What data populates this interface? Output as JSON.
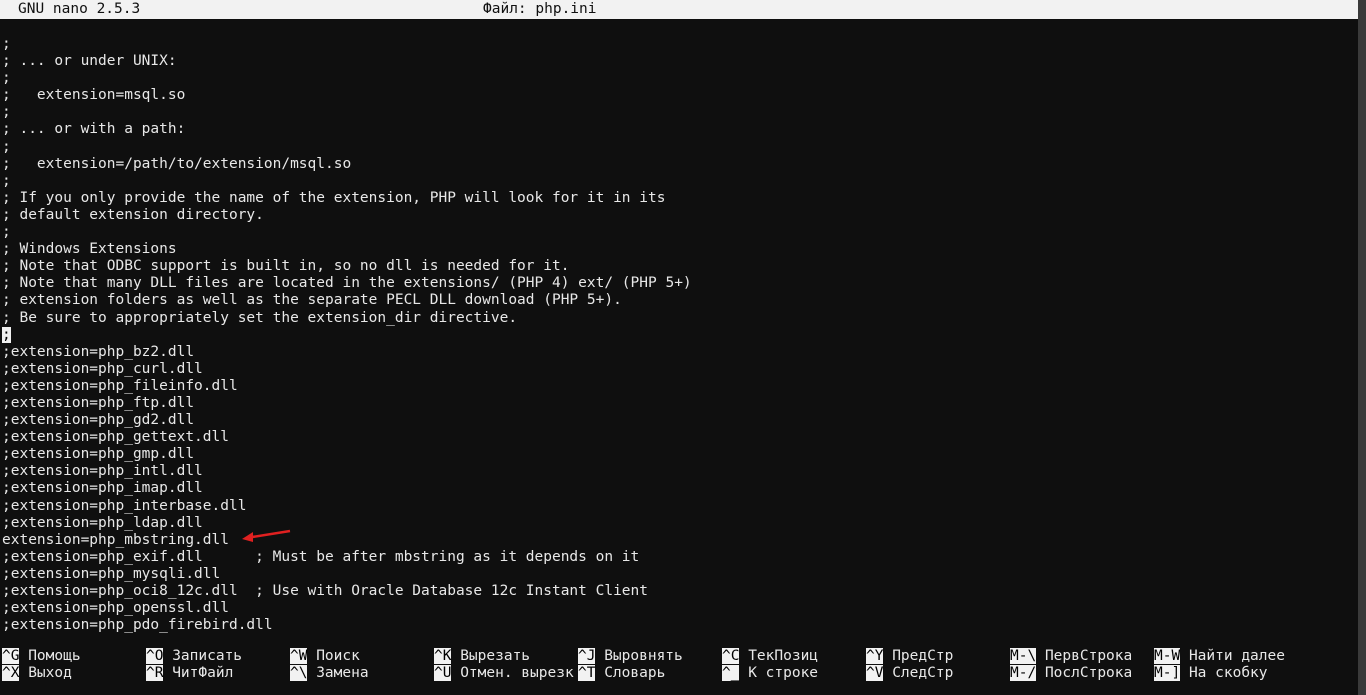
{
  "titlebar": {
    "app": "GNU nano 2.5.3",
    "file": "Файл: php.ini"
  },
  "lines": [
    ";",
    "; ... or under UNIX:",
    ";",
    ";   extension=msql.so",
    ";",
    "; ... or with a path:",
    ";",
    ";   extension=/path/to/extension/msql.so",
    ";",
    "; If you only provide the name of the extension, PHP will look for it in its",
    "; default extension directory.",
    ";",
    "; Windows Extensions",
    "; Note that ODBC support is built in, so no dll is needed for it.",
    "; Note that many DLL files are located in the extensions/ (PHP 4) ext/ (PHP 5+)",
    "; extension folders as well as the separate PECL DLL download (PHP 5+).",
    "; Be sure to appropriately set the extension_dir directive.",
    ";",
    ";extension=php_bz2.dll",
    ";extension=php_curl.dll",
    ";extension=php_fileinfo.dll",
    ";extension=php_ftp.dll",
    ";extension=php_gd2.dll",
    ";extension=php_gettext.dll",
    ";extension=php_gmp.dll",
    ";extension=php_intl.dll",
    ";extension=php_imap.dll",
    ";extension=php_interbase.dll",
    ";extension=php_ldap.dll",
    "extension=php_mbstring.dll",
    ";extension=php_exif.dll      ; Must be after mbstring as it depends on it",
    ";extension=php_mysqli.dll",
    ";extension=php_oci8_12c.dll  ; Use with Oracle Database 12c Instant Client",
    ";extension=php_openssl.dll",
    ";extension=php_pdo_firebird.dll"
  ],
  "cursor_line": 18,
  "annotation_color": "#e02020",
  "shortcuts": [
    {
      "key": "^G",
      "label": "Помощь"
    },
    {
      "key": "^X",
      "label": "Выход"
    },
    {
      "key": "^O",
      "label": "Записать"
    },
    {
      "key": "^R",
      "label": "ЧитФайл"
    },
    {
      "key": "^W",
      "label": "Поиск"
    },
    {
      "key": "^\\",
      "label": "Замена"
    },
    {
      "key": "^K",
      "label": "Вырезать"
    },
    {
      "key": "^U",
      "label": "Отмен. вырезк"
    },
    {
      "key": "^J",
      "label": "Выровнять"
    },
    {
      "key": "^T",
      "label": "Словарь"
    },
    {
      "key": "^C",
      "label": "ТекПозиц"
    },
    {
      "key": "^_",
      "label": "К строке"
    },
    {
      "key": "^Y",
      "label": "ПредСтр"
    },
    {
      "key": "^V",
      "label": "СледСтр"
    },
    {
      "key": "M-\\",
      "label": "ПервСтрока"
    },
    {
      "key": "M-/",
      "label": "ПослСтрока"
    },
    {
      "key": "M-W",
      "label": "Найти далее"
    },
    {
      "key": "M-]",
      "label": "На скобку"
    }
  ]
}
